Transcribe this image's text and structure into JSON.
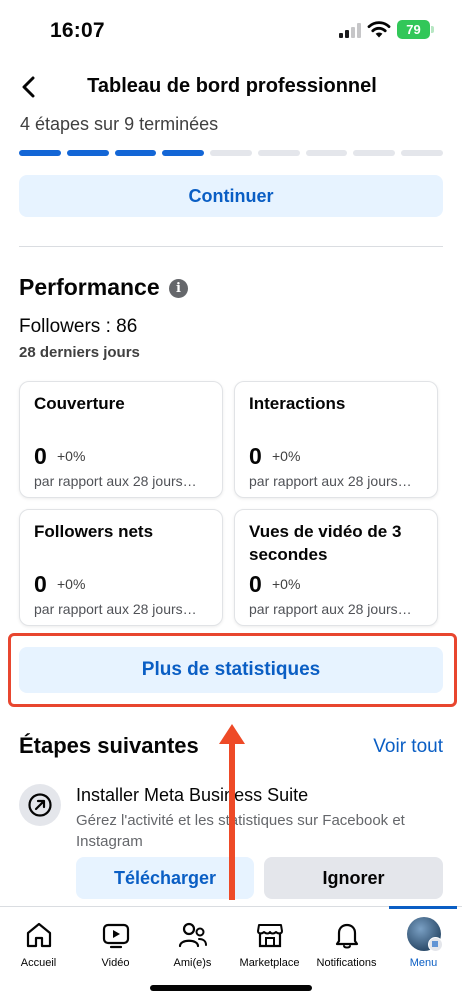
{
  "status": {
    "time": "16:07",
    "battery": "79"
  },
  "header": {
    "title": "Tableau de bord professionnel"
  },
  "setup": {
    "steps_text": "4 étapes sur 9 terminées",
    "completed": 4,
    "total": 9,
    "continue_label": "Continuer"
  },
  "performance": {
    "title": "Performance",
    "followers": "Followers : 86",
    "period": "28 derniers jours",
    "cards": [
      {
        "title": "Couverture",
        "value": "0",
        "delta": "+0%",
        "sub": "par rapport aux 28 jours…"
      },
      {
        "title": "Interactions",
        "value": "0",
        "delta": "+0%",
        "sub": "par rapport aux 28 jours…"
      },
      {
        "title": "Followers nets",
        "value": "0",
        "delta": "+0%",
        "sub": "par rapport aux 28 jours…"
      },
      {
        "title": "Vues de vidéo de 3 secondes",
        "value": "0",
        "delta": "+0%",
        "sub": "par rapport aux 28 jours…"
      }
    ],
    "more_stats_label": "Plus de statistiques"
  },
  "next_steps": {
    "title": "Étapes suivantes",
    "see_all": "Voir tout",
    "item": {
      "title": "Installer Meta Business Suite",
      "description": "Gérez l'activité et les statistiques sur Facebook et Instagram",
      "download_label": "Télécharger",
      "ignore_label": "Ignorer"
    }
  },
  "tabbar": {
    "items": [
      {
        "label": "Accueil",
        "icon": "home-icon"
      },
      {
        "label": "Vidéo",
        "icon": "video-icon"
      },
      {
        "label": "Ami(e)s",
        "icon": "friends-icon"
      },
      {
        "label": "Marketplace",
        "icon": "marketplace-icon"
      },
      {
        "label": "Notifications",
        "icon": "bell-icon"
      },
      {
        "label": "Menu",
        "icon": "avatar-icon"
      }
    ],
    "active": "Menu"
  },
  "colors": {
    "accent": "#0a5ec4",
    "progress": "#1366d6",
    "highlight": "#e8462f",
    "battery": "#32c759"
  }
}
